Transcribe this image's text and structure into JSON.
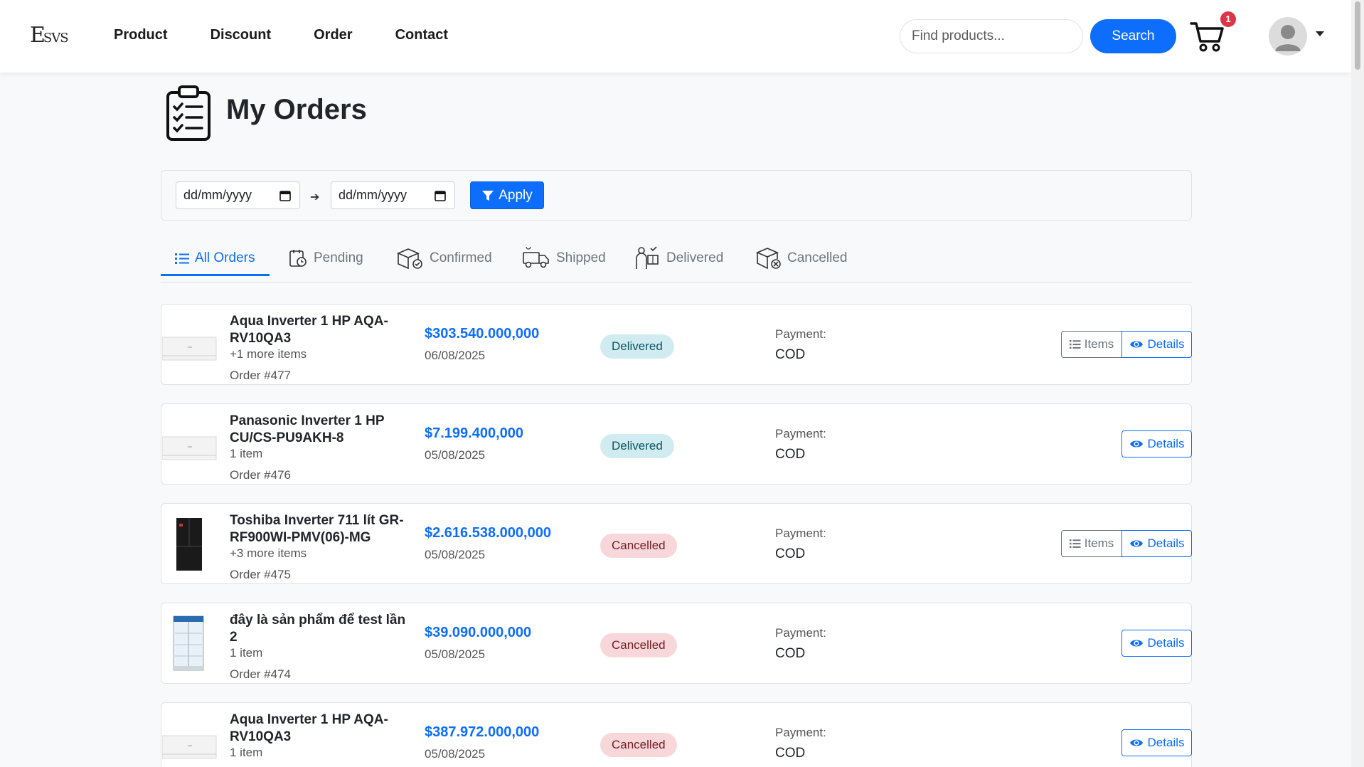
{
  "navbar": {
    "logo_text": "ESVS",
    "links": [
      "Product",
      "Discount",
      "Order",
      "Contact"
    ],
    "search_placeholder": "Find products...",
    "search_button": "Search",
    "cart_count": "1"
  },
  "page": {
    "title": "My Orders"
  },
  "filter": {
    "from_placeholder": "dd/mm/yyyy",
    "to_placeholder": "dd/mm/yyyy",
    "apply_label": "Apply"
  },
  "tabs": [
    {
      "label": "All Orders",
      "active": true
    },
    {
      "label": "Pending",
      "active": false
    },
    {
      "label": "Confirmed",
      "active": false
    },
    {
      "label": "Shipped",
      "active": false
    },
    {
      "label": "Delivered",
      "active": false
    },
    {
      "label": "Cancelled",
      "active": false
    }
  ],
  "orders": [
    {
      "name": "Aqua Inverter 1 HP AQA-RV10QA3",
      "items": "+1 more items",
      "order_no": "Order #477",
      "price": "$303.540.000,000",
      "date": "06/08/2025",
      "status": "Delivered",
      "payment_label": "Payment:",
      "payment": "COD",
      "items_button": "Items",
      "details_button": "Details",
      "thumb": "ac-unit"
    },
    {
      "name": "Panasonic Inverter 1 HP CU/CS-PU9AKH-8",
      "items": "1 item",
      "order_no": "Order #476",
      "price": "$7.199.400,000",
      "date": "05/08/2025",
      "status": "Delivered",
      "payment_label": "Payment:",
      "payment": "COD",
      "details_button": "Details",
      "thumb": "ac-unit"
    },
    {
      "name": "Toshiba Inverter 711 lít GR-RF900WI-PMV(06)-MG",
      "items": "+3 more items",
      "order_no": "Order #475",
      "price": "$2.616.538.000,000",
      "date": "05/08/2025",
      "status": "Cancelled",
      "payment_label": "Payment:",
      "payment": "COD",
      "items_button": "Items",
      "details_button": "Details",
      "thumb": "fridge"
    },
    {
      "name": "đây là sản phẩm để test lần 2",
      "items": "1 item",
      "order_no": "Order #474",
      "price": "$39.090.000,000",
      "date": "05/08/2025",
      "status": "Cancelled",
      "payment_label": "Payment:",
      "payment": "COD",
      "details_button": "Details",
      "thumb": "display-fridge"
    },
    {
      "name": "Aqua Inverter 1 HP AQA-RV10QA3",
      "items": "1 item",
      "order_no": "",
      "price": "$387.972.000,000",
      "date": "05/08/2025",
      "status": "Cancelled",
      "payment_label": "Payment:",
      "payment": "COD",
      "details_button": "Details",
      "thumb": "ac-unit"
    }
  ]
}
